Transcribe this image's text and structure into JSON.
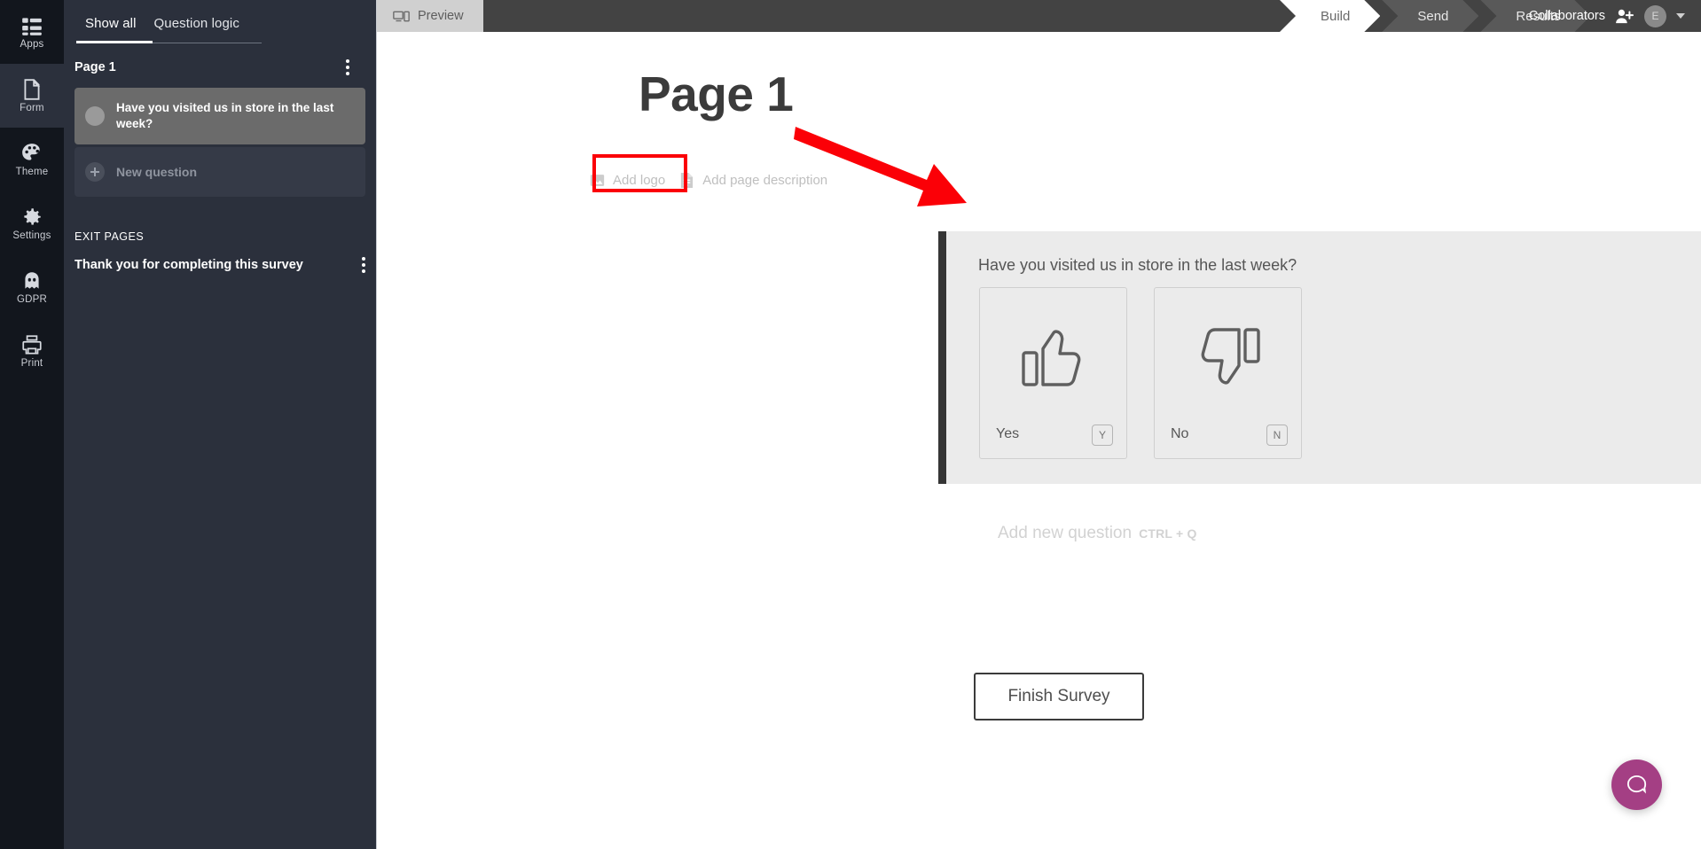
{
  "rail": {
    "items": [
      {
        "label": "Apps",
        "icon": "apps-grid-icon"
      },
      {
        "label": "Form",
        "icon": "document-page-icon"
      },
      {
        "label": "Theme",
        "icon": "palette-icon"
      },
      {
        "label": "Settings",
        "icon": "gear-icon"
      },
      {
        "label": "GDPR",
        "icon": "ghost-icon"
      },
      {
        "label": "Print",
        "icon": "printer-icon"
      }
    ]
  },
  "sidebar": {
    "tabs": [
      {
        "label": "Show all",
        "active": true
      },
      {
        "label": "Question logic",
        "active": false
      }
    ],
    "page_title": "Page 1",
    "questions": [
      {
        "label": "Have you visited us in store in the last week?",
        "state": "selected"
      },
      {
        "label": "New question",
        "state": "new"
      }
    ],
    "exit_pages_label": "EXIT PAGES",
    "exit_pages": [
      {
        "label": "Thank you for completing this survey"
      }
    ]
  },
  "topbar": {
    "preview_label": "Preview",
    "steps": [
      {
        "label": "Build",
        "active": true
      },
      {
        "label": "Send",
        "active": false
      },
      {
        "label": "Results",
        "active": false
      }
    ],
    "collaborators_label": "Collaborators",
    "avatar_initial": "E"
  },
  "canvas": {
    "page_heading": "Page 1",
    "add_logo_label": "Add logo",
    "add_page_description_label": "Add page description",
    "question": {
      "title": "Have you visited us in store in the last week?",
      "choices": [
        {
          "label": "Yes",
          "key": "Y",
          "icon": "thumbs-up-icon"
        },
        {
          "label": "No",
          "key": "N",
          "icon": "thumbs-down-icon"
        }
      ]
    },
    "add_new_question_label": "Add new question",
    "add_new_question_shortcut": "CTRL + Q",
    "finish_button_label": "Finish Survey"
  },
  "colors": {
    "rail_bg": "#12161d",
    "sidebar_bg": "#2b303c",
    "topbar_bg": "#434343",
    "annotation_red": "#fb0007",
    "chat_magenta": "#a43f84",
    "question_block_bg": "#ebebeb"
  }
}
